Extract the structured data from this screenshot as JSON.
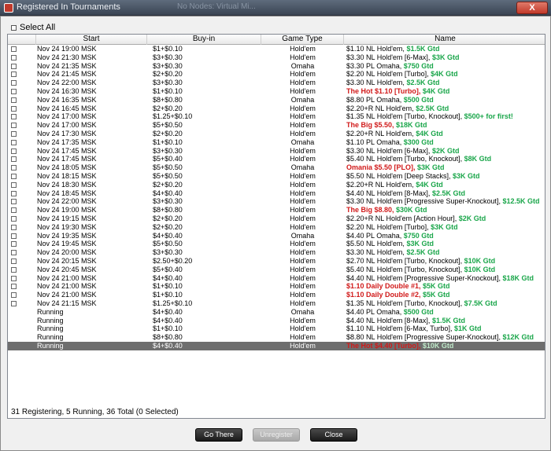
{
  "window": {
    "title": "Registered In Tournaments",
    "ghost_left": "No Nodes: Virtual Mi...",
    "close": "X"
  },
  "select_all_label": "Select All",
  "columns": {
    "start": "Start",
    "buyin": "Buy-in",
    "game": "Game Type",
    "name": "Name"
  },
  "rows": [
    {
      "checkbox": true,
      "start": "Nov 24  19:00 MSK",
      "buyin": "$1+$0.10",
      "game": "Hold'em",
      "name": "$1.10 NL Hold'em, ",
      "gtd": "$1.5K Gtd",
      "hot": false
    },
    {
      "checkbox": true,
      "start": "Nov 24  21:30 MSK",
      "buyin": "$3+$0.30",
      "game": "Hold'em",
      "name": "$3.30 NL Hold'em [6-Max], ",
      "gtd": "$3K Gtd",
      "hot": false
    },
    {
      "checkbox": true,
      "start": "Nov 24  21:35 MSK",
      "buyin": "$3+$0.30",
      "game": "Omaha",
      "name": "$3.30 PL Omaha, ",
      "gtd": "$750 Gtd",
      "hot": false
    },
    {
      "checkbox": true,
      "start": "Nov 24  21:45 MSK",
      "buyin": "$2+$0.20",
      "game": "Hold'em",
      "name": "$2.20 NL Hold'em [Turbo], ",
      "gtd": "$4K Gtd",
      "hot": false
    },
    {
      "checkbox": true,
      "start": "Nov 24  22:00 MSK",
      "buyin": "$3+$0.30",
      "game": "Hold'em",
      "name": "$3.30 NL Hold'em, ",
      "gtd": "$2.5K Gtd",
      "hot": false
    },
    {
      "checkbox": true,
      "start": "Nov 24  16:30 MSK",
      "buyin": "$1+$0.10",
      "game": "Hold'em",
      "name": "The Hot $1.10 [Turbo], ",
      "gtd": "$4K Gtd",
      "hot": true
    },
    {
      "checkbox": true,
      "start": "Nov 24  16:35 MSK",
      "buyin": "$8+$0.80",
      "game": "Omaha",
      "name": "$8.80 PL Omaha, ",
      "gtd": "$500 Gtd",
      "hot": false
    },
    {
      "checkbox": true,
      "start": "Nov 24  16:45 MSK",
      "buyin": "$2+$0.20",
      "game": "Hold'em",
      "name": "$2.20+R NL Hold'em, ",
      "gtd": "$2.5K Gtd",
      "hot": false
    },
    {
      "checkbox": true,
      "start": "Nov 24  17:00 MSK",
      "buyin": "$1.25+$0.10",
      "game": "Hold'em",
      "name": "$1.35 NL Hold'em [Turbo, Knockout], ",
      "gtd": "$500+ for first!",
      "hot": false
    },
    {
      "checkbox": true,
      "start": "Nov 24  17:00 MSK",
      "buyin": "$5+$0.50",
      "game": "Hold'em",
      "name": "The Big $5.50, ",
      "gtd": "$18K Gtd",
      "hot": true
    },
    {
      "checkbox": true,
      "start": "Nov 24  17:30 MSK",
      "buyin": "$2+$0.20",
      "game": "Hold'em",
      "name": "$2.20+R NL Hold'em, ",
      "gtd": "$4K Gtd",
      "hot": false
    },
    {
      "checkbox": true,
      "start": "Nov 24  17:35 MSK",
      "buyin": "$1+$0.10",
      "game": "Omaha",
      "name": "$1.10 PL Omaha, ",
      "gtd": "$300 Gtd",
      "hot": false
    },
    {
      "checkbox": true,
      "start": "Nov 24  17:45 MSK",
      "buyin": "$3+$0.30",
      "game": "Hold'em",
      "name": "$3.30 NL Hold'em [6-Max], ",
      "gtd": "$2K Gtd",
      "hot": false
    },
    {
      "checkbox": true,
      "start": "Nov 24  17:45 MSK",
      "buyin": "$5+$0.40",
      "game": "Hold'em",
      "name": "$5.40 NL Hold'em [Turbo, Knockout], ",
      "gtd": "$8K Gtd",
      "hot": false
    },
    {
      "checkbox": true,
      "start": "Nov 24  18:05 MSK",
      "buyin": "$5+$0.50",
      "game": "Omaha",
      "name": "Omania $5.50 [PLO], ",
      "gtd": "$3K Gtd",
      "hot": true
    },
    {
      "checkbox": true,
      "start": "Nov 24  18:15 MSK",
      "buyin": "$5+$0.50",
      "game": "Hold'em",
      "name": "$5.50 NL Hold'em [Deep Stacks], ",
      "gtd": "$3K Gtd",
      "hot": false
    },
    {
      "checkbox": true,
      "start": "Nov 24  18:30 MSK",
      "buyin": "$2+$0.20",
      "game": "Hold'em",
      "name": "$2.20+R NL Hold'em, ",
      "gtd": "$4K Gtd",
      "hot": false
    },
    {
      "checkbox": true,
      "start": "Nov 24  18:45 MSK",
      "buyin": "$4+$0.40",
      "game": "Hold'em",
      "name": "$4.40 NL Hold'em [8-Max], ",
      "gtd": "$2.5K Gtd",
      "hot": false
    },
    {
      "checkbox": true,
      "start": "Nov 24  22:00 MSK",
      "buyin": "$3+$0.30",
      "game": "Hold'em",
      "name": "$3.30 NL Hold'em [Progressive Super-Knockout], ",
      "gtd": "$12.5K Gtd",
      "hot": false
    },
    {
      "checkbox": true,
      "start": "Nov 24  19:00 MSK",
      "buyin": "$8+$0.80",
      "game": "Hold'em",
      "name": "The Big $8.80, ",
      "gtd": "$30K Gtd",
      "hot": true
    },
    {
      "checkbox": true,
      "start": "Nov 24  19:15 MSK",
      "buyin": "$2+$0.20",
      "game": "Hold'em",
      "name": "$2.20+R NL Hold'em [Action Hour], ",
      "gtd": "$2K Gtd",
      "hot": false
    },
    {
      "checkbox": true,
      "start": "Nov 24  19:30 MSK",
      "buyin": "$2+$0.20",
      "game": "Hold'em",
      "name": "$2.20 NL Hold'em [Turbo], ",
      "gtd": "$3K Gtd",
      "hot": false
    },
    {
      "checkbox": true,
      "start": "Nov 24  19:35 MSK",
      "buyin": "$4+$0.40",
      "game": "Omaha",
      "name": "$4.40 PL Omaha, ",
      "gtd": "$750 Gtd",
      "hot": false
    },
    {
      "checkbox": true,
      "start": "Nov 24  19:45 MSK",
      "buyin": "$5+$0.50",
      "game": "Hold'em",
      "name": "$5.50 NL Hold'em, ",
      "gtd": "$3K Gtd",
      "hot": false
    },
    {
      "checkbox": true,
      "start": "Nov 24  20:00 MSK",
      "buyin": "$3+$0.30",
      "game": "Hold'em",
      "name": "$3.30 NL Hold'em, ",
      "gtd": "$2.5K Gtd",
      "hot": false
    },
    {
      "checkbox": true,
      "start": "Nov 24  20:15 MSK",
      "buyin": "$2.50+$0.20",
      "game": "Hold'em",
      "name": "$2.70 NL Hold'em [Turbo, Knockout], ",
      "gtd": "$10K Gtd",
      "hot": false
    },
    {
      "checkbox": true,
      "start": "Nov 24  20:45 MSK",
      "buyin": "$5+$0.40",
      "game": "Hold'em",
      "name": "$5.40 NL Hold'em [Turbo, Knockout], ",
      "gtd": "$10K Gtd",
      "hot": false
    },
    {
      "checkbox": true,
      "start": "Nov 24  21:00 MSK",
      "buyin": "$4+$0.40",
      "game": "Hold'em",
      "name": "$4.40 NL Hold'em [Progressive Super-Knockout], ",
      "gtd": "$18K Gtd",
      "hot": false
    },
    {
      "checkbox": true,
      "start": "Nov 24  21:00 MSK",
      "buyin": "$1+$0.10",
      "game": "Hold'em",
      "name": "$1.10 Daily Double #1, ",
      "gtd": "$5K Gtd",
      "hot": true
    },
    {
      "checkbox": true,
      "start": "Nov 24  21:00 MSK",
      "buyin": "$1+$0.10",
      "game": "Hold'em",
      "name": "$1.10 Daily Double #2, ",
      "gtd": "$5K Gtd",
      "hot": true
    },
    {
      "checkbox": true,
      "start": "Nov 24  21:15 MSK",
      "buyin": "$1.25+$0.10",
      "game": "Hold'em",
      "name": "$1.35 NL Hold'em [Turbo, Knockout], ",
      "gtd": "$7.5K Gtd",
      "hot": false
    },
    {
      "checkbox": false,
      "start": "Running",
      "buyin": "$4+$0.40",
      "game": "Omaha",
      "name": "$4.40 PL Omaha, ",
      "gtd": "$500 Gtd",
      "hot": false
    },
    {
      "checkbox": false,
      "start": "Running",
      "buyin": "$4+$0.40",
      "game": "Hold'em",
      "name": "$4.40 NL Hold'em [8-Max], ",
      "gtd": "$1.5K Gtd",
      "hot": false
    },
    {
      "checkbox": false,
      "start": "Running",
      "buyin": "$1+$0.10",
      "game": "Hold'em",
      "name": "$1.10 NL Hold'em [6-Max, Turbo], ",
      "gtd": "$1K Gtd",
      "hot": false
    },
    {
      "checkbox": false,
      "start": "Running",
      "buyin": "$8+$0.80",
      "game": "Hold'em",
      "name": "$8.80 NL Hold'em [Progressive Super-Knockout], ",
      "gtd": "$12K Gtd",
      "hot": false
    },
    {
      "checkbox": false,
      "start": "Running",
      "buyin": "$4+$0.40",
      "game": "Hold'em",
      "name": "The Hot $4.40 [Turbo], ",
      "gtd": "$10K Gtd",
      "hot": true,
      "selected": true
    }
  ],
  "status": "31 Registering, 5 Running, 36 Total (0 Selected)",
  "buttons": {
    "go_there": "Go There",
    "unregister": "Unregister",
    "close": "Close"
  }
}
